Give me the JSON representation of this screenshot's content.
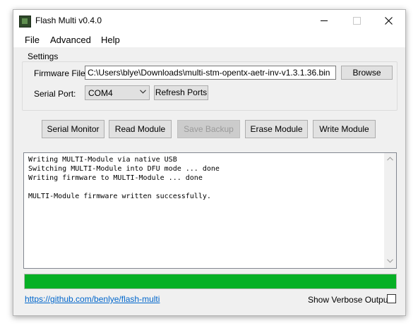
{
  "window": {
    "title": "Flash Multi v0.4.0",
    "icon": "flash-multi-app-icon"
  },
  "menu": {
    "items": [
      "File",
      "Advanced",
      "Help"
    ]
  },
  "settings": {
    "group_label": "Settings",
    "firmware_label": "Firmware File:",
    "firmware_value": "C:\\Users\\blye\\Downloads\\multi-stm-opentx-aetr-inv-v1.3.1.36.bin",
    "browse_label": "Browse",
    "serial_label": "Serial Port:",
    "serial_value": "COM4",
    "refresh_label": "Refresh Ports"
  },
  "actions": {
    "serial_monitor": "Serial Monitor",
    "read_module": "Read Module",
    "save_backup": "Save Backup",
    "save_backup_enabled": false,
    "erase_module": "Erase Module",
    "write_module": "Write Module"
  },
  "log": {
    "lines": [
      "Writing MULTI-Module via native USB",
      "Switching MULTI-Module into DFU mode ... done",
      "Writing firmware to MULTI-Module ... done",
      "",
      "MULTI-Module firmware written successfully."
    ]
  },
  "progress": {
    "value_percent": 100,
    "color": "#06b025"
  },
  "footer": {
    "link_text": "https://github.com/benlye/flash-multi",
    "verbose_label": "Show Verbose Output",
    "verbose_checked": false
  }
}
